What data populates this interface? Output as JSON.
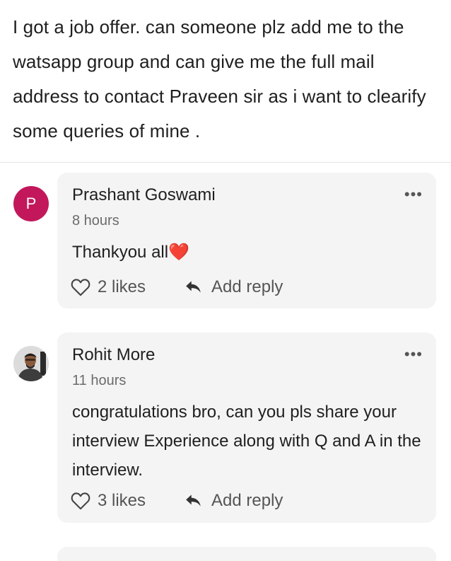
{
  "post": {
    "text": "I got a job offer. can someone plz add me to the watsapp group and can give me the full mail address to contact Praveen sir as  i want to clearify some queries of mine ."
  },
  "comments": [
    {
      "avatar_letter": "P",
      "avatar_color": "#c2185b",
      "author": "Prashant Goswami",
      "time": "8 hours",
      "text": "Thankyou all❤️",
      "likes": "2 likes",
      "reply_label": "Add reply"
    },
    {
      "avatar_icon": "user-photo-avatar",
      "author": "Rohit More",
      "time": "11 hours",
      "text": "congratulations bro, can you pls share your interview Experience along with Q and A in the interview.",
      "likes": "3 likes",
      "reply_label": "Add reply"
    }
  ],
  "more_label": "•••",
  "colors": {
    "comment_bg": "#f4f4f4",
    "muted_text": "#6b6b6b",
    "avatar_p": "#c2185b"
  }
}
